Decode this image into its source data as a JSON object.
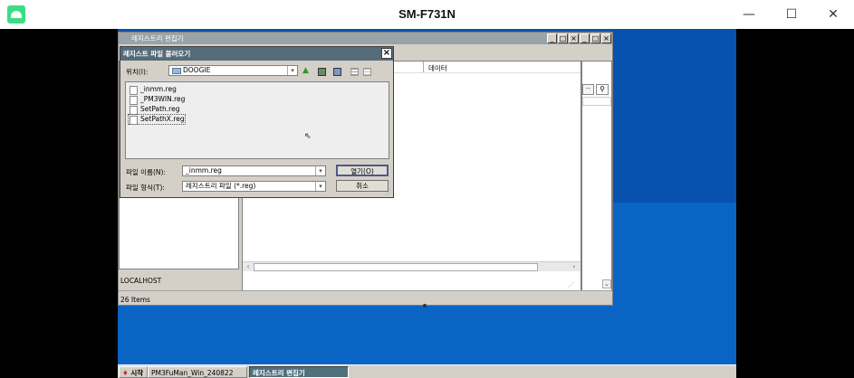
{
  "window": {
    "title": "SM-F731N",
    "minimize_glyph": "—",
    "maximize_glyph": "☐",
    "close_glyph": "✕"
  },
  "regedit": {
    "title": "레지스트리 편집기",
    "column_data": "데이터",
    "status_path": "LOCALHOST",
    "status_count": "26 Items",
    "min_glyph": "_",
    "max_glyph": "□",
    "close_glyph": "×"
  },
  "dialog": {
    "title": "레지스트 파일 불러오기",
    "close_glyph": "×",
    "location_label": "위치(I):",
    "location_value": "DOOGIE",
    "files": [
      "_inmm.reg",
      "_PM3WIN.reg",
      "SetPath.reg",
      "SetPathX.reg"
    ],
    "filename_label": "파일 이름(N):",
    "filename_value": "_inmm.reg",
    "filetype_label": "파일 형식(T):",
    "filetype_value": "레지스트리 파일 (*.reg)",
    "open_button": "열기(O)",
    "cancel_button": "취소"
  },
  "taskbar": {
    "start": "시작",
    "tasks": [
      "PM3FuMan_Win_240822",
      "레지스트리 편집기"
    ]
  },
  "colors": {
    "desktop": "#0a64c4",
    "dialog_title": "#566b78",
    "taskbar_active": "#50707c"
  }
}
